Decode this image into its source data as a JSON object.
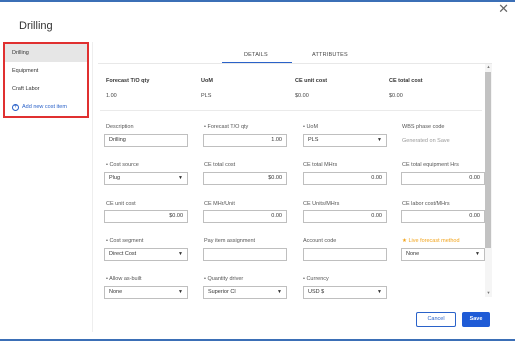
{
  "page_title": "Drilling",
  "sidebar": {
    "items": [
      {
        "label": "Drilling"
      },
      {
        "label": "Equipment"
      },
      {
        "label": "Craft Labor"
      }
    ],
    "add_label": "Add new cost item"
  },
  "tabs": [
    {
      "label": "DETAILS"
    },
    {
      "label": "ATTRIBUTES"
    }
  ],
  "summary": {
    "forecast_qty": {
      "label": "Forecast T/O qty",
      "value": "1.00"
    },
    "uom": {
      "label": "UoM",
      "value": "PLS"
    },
    "ce_unit_cost": {
      "label": "CE unit cost",
      "value": "$0.00"
    },
    "ce_total_cost": {
      "label": "CE total cost",
      "value": "$0.00"
    }
  },
  "form": {
    "description": {
      "label": "Description",
      "value": "Drilling"
    },
    "forecast_qty": {
      "label": "• Forecast T/O qty",
      "value": "1.00"
    },
    "uom": {
      "label": "• UoM",
      "value": "PLS"
    },
    "wbs": {
      "label": "WBS phase code",
      "value": "Generated on Save"
    },
    "cost_source": {
      "label": "• Cost source",
      "value": "Plug"
    },
    "ce_total_cost": {
      "label": "CE total cost",
      "value": "$0.00"
    },
    "ce_total_mhrs": {
      "label": "CE total MHrs",
      "value": "0.00"
    },
    "ce_total_equip": {
      "label": "CE total equipment Hrs",
      "value": "0.00"
    },
    "ce_unit_cost": {
      "label": "CE unit cost",
      "value": "$0.00"
    },
    "ce_mhr_unit": {
      "label": "CE MHr/Unit",
      "value": "0.00"
    },
    "ce_units_mhrs": {
      "label": "CE Units/MHrs",
      "value": "0.00"
    },
    "ce_labor_cost": {
      "label": "CE labor cost/MHrs",
      "value": "0.00"
    },
    "cost_segment": {
      "label": "• Cost segment",
      "value": "Direct Cost"
    },
    "pay_item": {
      "label": "Pay item assignment",
      "value": ""
    },
    "account_code": {
      "label": "Account code",
      "value": ""
    },
    "live_forecast": {
      "label": "★ Live forecast method",
      "value": "None"
    },
    "allow_as_built": {
      "label": "• Allow as-built",
      "value": "None"
    },
    "quantity_driver": {
      "label": "• Quantity driver",
      "value": "Superior CI"
    },
    "currency": {
      "label": "• Currency",
      "value": "USD $"
    }
  },
  "buttons": {
    "cancel": "Cancel",
    "save": "Save"
  },
  "colors": {
    "accent": "#2a62c9",
    "highlight_border": "#e03030",
    "warning": "#f2a41c"
  }
}
